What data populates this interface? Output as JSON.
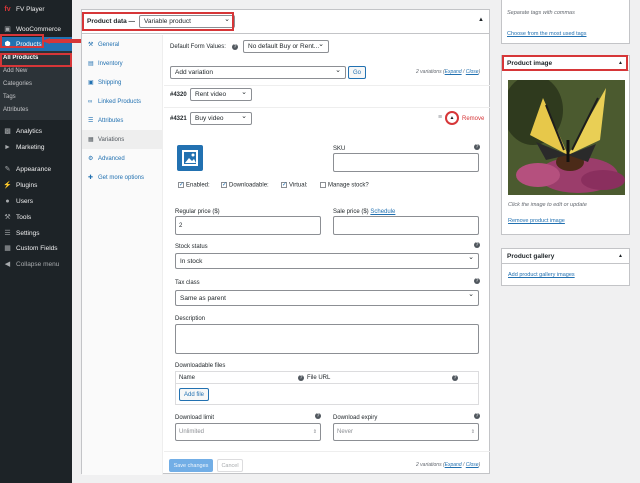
{
  "sidebar": {
    "fv_player": "FV Player",
    "woocommerce": "WooCommerce",
    "products": "Products",
    "sub": [
      "All Products",
      "Add New",
      "Categories",
      "Tags",
      "Attributes"
    ],
    "items": [
      "Analytics",
      "Marketing",
      "Appearance",
      "Plugins",
      "Users",
      "Tools",
      "Settings",
      "Custom Fields"
    ],
    "collapse": "Collapse menu"
  },
  "product_data": {
    "label": "Product data —",
    "type": "Variable product",
    "tabs": [
      "General",
      "Inventory",
      "Shipping",
      "Linked Products",
      "Attributes",
      "Variations",
      "Advanced",
      "Get more options"
    ],
    "default_form_values": "Default Form Values:",
    "default_select": "No default Buy or Rent...",
    "add_variation": "Add variation",
    "go": "Go",
    "count_text": "2 variations",
    "expand": "Expand",
    "close": "Close",
    "v1_id": "#4320",
    "v1_value": "Rent video",
    "v2_id": "#4321",
    "v2_value": "Buy video",
    "remove": "Remove",
    "sku_label": "SKU",
    "enabled": "Enabled:",
    "downloadable": "Downloadable:",
    "virtual": "Virtual:",
    "manage_stock": "Manage stock?",
    "regular_price_label": "Regular price ($)",
    "regular_price": "2",
    "sale_price_label": "Sale price ($)",
    "schedule": "Schedule",
    "stock_status_label": "Stock status",
    "stock_status": "In stock",
    "tax_class_label": "Tax class",
    "tax_class": "Same as parent",
    "description_label": "Description",
    "downloadable_files_label": "Downloadable files",
    "col_name": "Name",
    "col_file_url": "File URL",
    "add_file": "Add file",
    "download_limit_label": "Download limit",
    "download_limit_placeholder": "Unlimited",
    "download_expiry_label": "Download expiry",
    "download_expiry_placeholder": "Never",
    "save_changes": "Save changes",
    "cancel": "Cancel"
  },
  "tags_box": {
    "hint": "Separate tags with commas",
    "choose": "Choose from the most used tags"
  },
  "product_image": {
    "title": "Product image",
    "hint": "Click the image to edit or update",
    "remove": "Remove product image"
  },
  "product_gallery": {
    "title": "Product gallery",
    "add": "Add product gallery images"
  },
  "colors": {
    "accent": "#2271b1",
    "highlight": "#d63638",
    "sidebar": "#1d2327"
  }
}
